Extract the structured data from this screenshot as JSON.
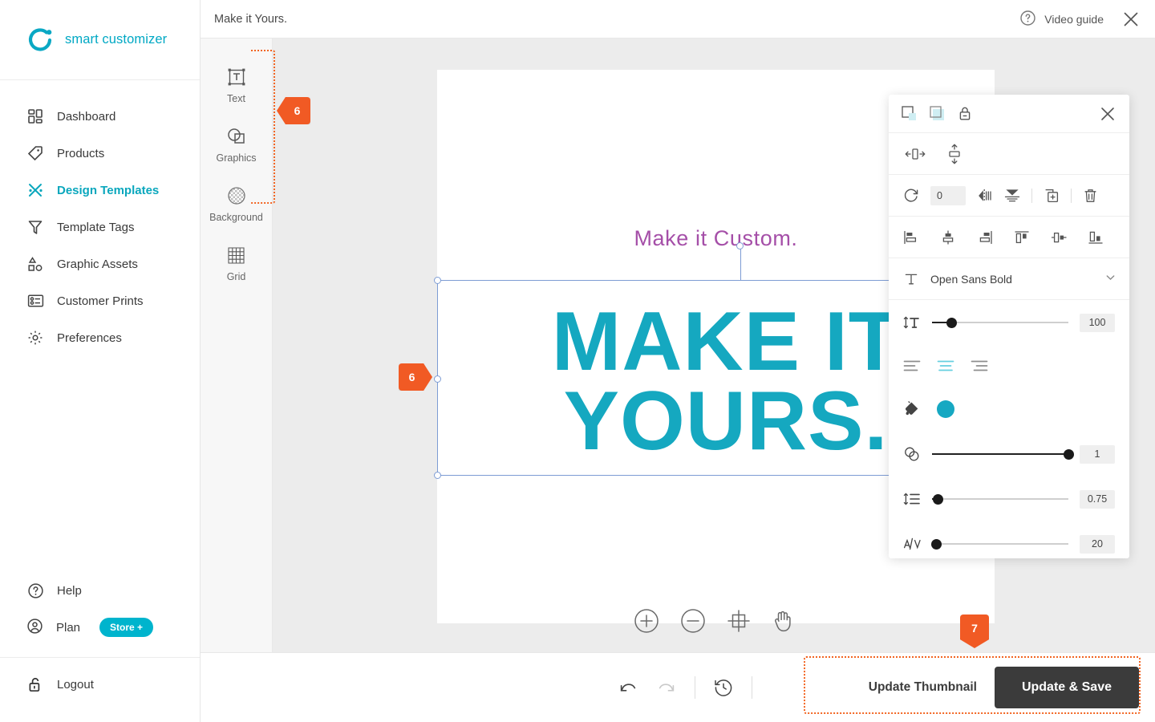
{
  "brand": {
    "name": "smart customizer",
    "logo_icon": "ring-dot-logo",
    "accent": "#00a8c4"
  },
  "sidebar": {
    "items": [
      {
        "label": "Dashboard",
        "icon": "grid-icon",
        "active": false
      },
      {
        "label": "Products",
        "icon": "tag-icon",
        "active": false
      },
      {
        "label": "Design Templates",
        "icon": "scissors-icon",
        "active": true
      },
      {
        "label": "Template Tags",
        "icon": "funnel-icon",
        "active": false
      },
      {
        "label": "Graphic Assets",
        "icon": "shapes-icon",
        "active": false
      },
      {
        "label": "Customer Prints",
        "icon": "prints-icon",
        "active": false
      },
      {
        "label": "Preferences",
        "icon": "gear-icon",
        "active": false
      }
    ],
    "help": {
      "label": "Help",
      "icon": "question-circle-icon"
    },
    "plan": {
      "label": "Plan",
      "icon": "user-circle-icon",
      "badge": "Store +"
    },
    "logout": {
      "label": "Logout",
      "icon": "unlock-icon"
    }
  },
  "topbar": {
    "title": "Make it Yours.",
    "video_guide": "Video guide",
    "video_guide_icon": "question-circle-icon",
    "close_icon": "close-icon"
  },
  "toolrail": {
    "tools": [
      {
        "label": "Text",
        "icon": "text-box-icon"
      },
      {
        "label": "Graphics",
        "icon": "shapes-overlap-icon"
      },
      {
        "label": "Background",
        "icon": "checker-circle-icon"
      },
      {
        "label": "Grid",
        "icon": "grid-lines-icon"
      }
    ]
  },
  "callouts": [
    {
      "number": "6",
      "direction": "left",
      "target": "toolrail"
    },
    {
      "number": "6",
      "direction": "right",
      "target": "canvas-selection"
    },
    {
      "number": "7",
      "direction": "down",
      "target": "save-actions"
    }
  ],
  "canvas": {
    "subtitle_text": "Make it Custom.",
    "subtitle_color": "#a54fa8",
    "headline_text": "MAKE IT YOURS.",
    "headline_line1": "MAKE IT",
    "headline_line2": "YOURS.",
    "headline_color": "#15a8c0",
    "tools": [
      {
        "label": "Zoom in",
        "icon": "plus-circle-icon"
      },
      {
        "label": "Zoom out",
        "icon": "minus-circle-icon"
      },
      {
        "label": "Fit to screen",
        "icon": "crosshair-frame-icon"
      },
      {
        "label": "Pan",
        "icon": "hand-icon"
      }
    ]
  },
  "properties": {
    "close_icon": "close-icon",
    "row_object": [
      {
        "name": "fill-transparency-icon",
        "label": "Fill transparency"
      },
      {
        "name": "stroke-transparency-icon",
        "label": "Stroke transparency"
      },
      {
        "name": "lock-icon",
        "label": "Lock"
      }
    ],
    "row_fit": [
      {
        "name": "fit-horizontal-icon",
        "label": "Fit horizontally"
      },
      {
        "name": "fit-vertical-icon",
        "label": "Fit vertically"
      }
    ],
    "row_transform": {
      "rotate_icon": "rotate-icon",
      "rotation_value": "0",
      "flip_horizontal_icon": "flip-horizontal-icon",
      "flip_vertical_icon": "flip-vertical-icon",
      "duplicate_icon": "duplicate-icon",
      "delete_icon": "trash-icon"
    },
    "row_align": [
      {
        "name": "align-left-icon",
        "label": "Align left"
      },
      {
        "name": "align-center-icon",
        "label": "Align center"
      },
      {
        "name": "align-right-icon",
        "label": "Align right"
      },
      {
        "name": "align-top-icon",
        "label": "Align top"
      },
      {
        "name": "align-middle-icon",
        "label": "Align middle"
      },
      {
        "name": "align-bottom-icon",
        "label": "Align bottom"
      }
    ],
    "font": {
      "icon": "font-t-icon",
      "name": "Open Sans Bold",
      "caret": "chevron-down-icon"
    },
    "font_size": {
      "icon": "font-size-icon",
      "value": "100",
      "percent": 14
    },
    "text_align": [
      {
        "name": "text-align-left-icon",
        "selected": false
      },
      {
        "name": "text-align-center-icon",
        "selected": true
      },
      {
        "name": "text-align-right-icon",
        "selected": false
      }
    ],
    "fill": {
      "icon": "paint-bucket-icon",
      "color": "#16a8c2"
    },
    "opacity": {
      "icon": "opacity-circles-icon",
      "value": "1",
      "percent": 100
    },
    "line_height": {
      "icon": "line-height-icon",
      "value": "0.75",
      "percent": 4
    },
    "letter_spacing": {
      "icon": "letter-spacing-icon",
      "value": "20",
      "percent": 2
    }
  },
  "bottombar": {
    "undo_icon": "undo-icon",
    "redo_icon": "redo-icon",
    "history_icon": "history-clock-icon",
    "update_thumbnail": "Update Thumbnail",
    "update_save": "Update & Save"
  }
}
